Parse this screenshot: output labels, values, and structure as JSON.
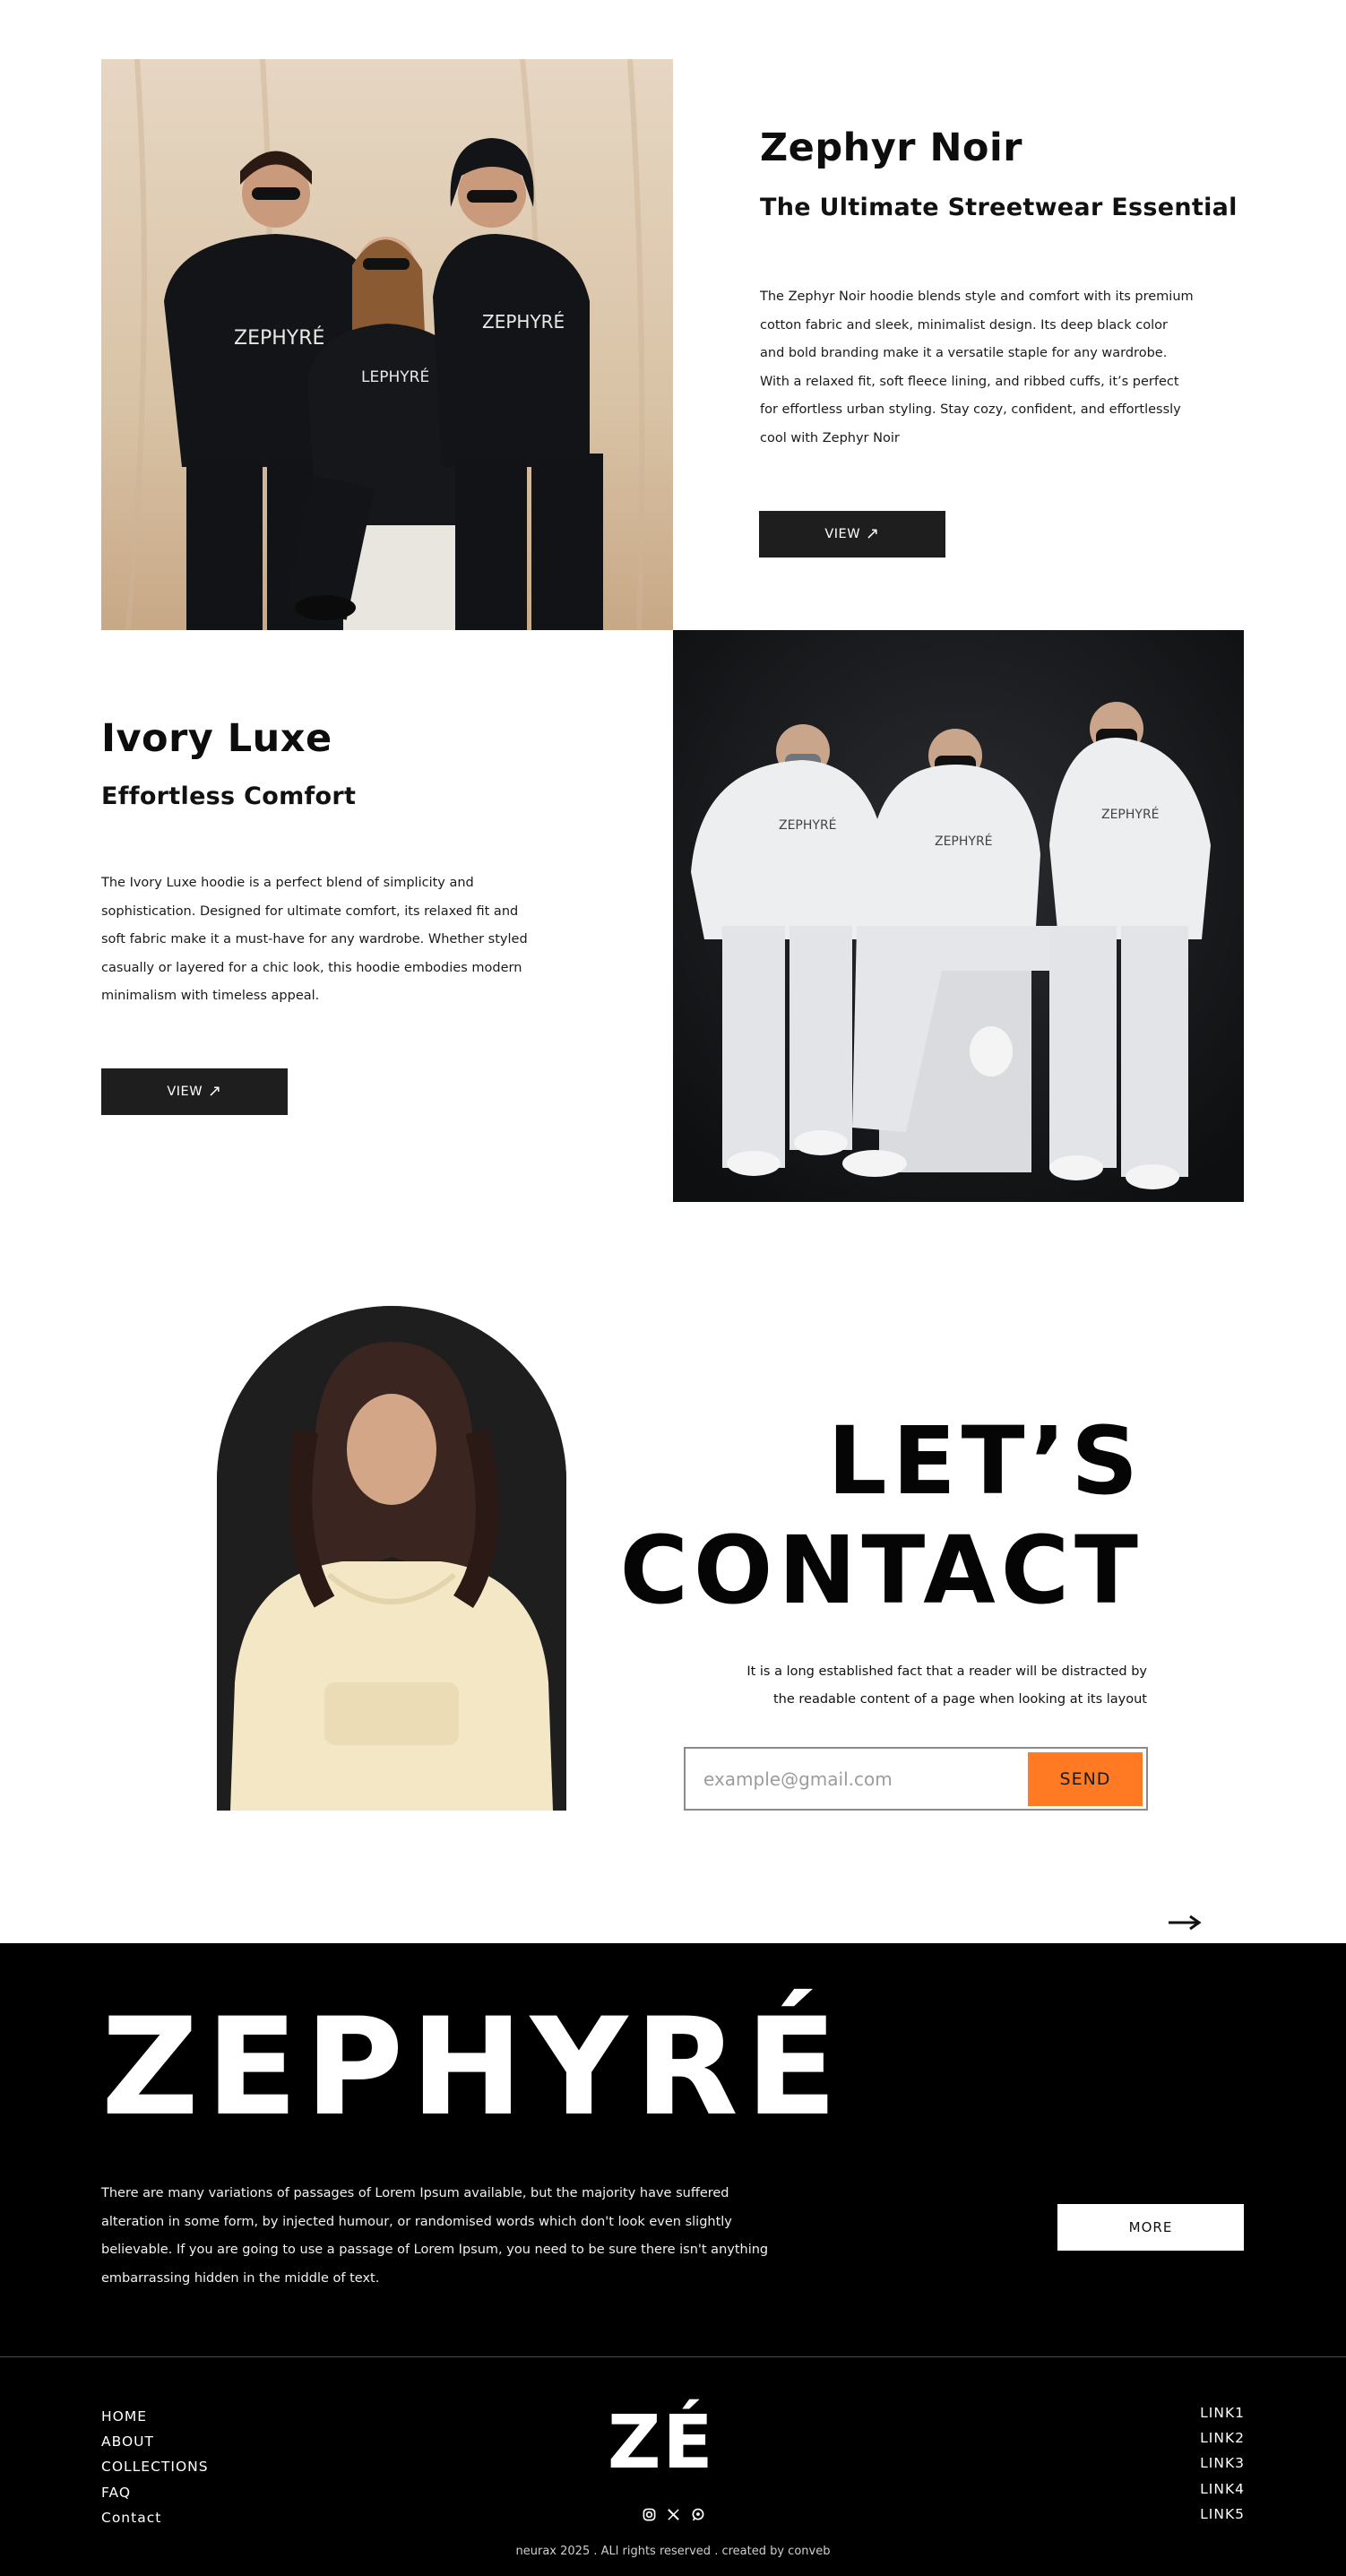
{
  "products": [
    {
      "title": "Zephyr Noir",
      "subtitle": "The Ultimate Streetwear Essential",
      "description_lines": [
        "The Zephyr Noir hoodie blends style and comfort with its premium",
        "cotton fabric and sleek, minimalist design. Its deep black color",
        "and bold branding make it a versatile staple for any wardrobe.",
        "With a relaxed fit, soft fleece lining, and ribbed cuffs, it’s perfect",
        "for effortless urban styling. Stay cozy, confident, and effortlessly",
        "cool with Zephyr Noir"
      ],
      "button_label": "VIEW",
      "hoodie_print": "ZEPHYRÉ"
    },
    {
      "title": "Ivory Luxe",
      "subtitle": "Effortless Comfort",
      "description_lines": [
        "The Ivory Luxe hoodie is a perfect blend of simplicity and",
        "sophistication. Designed for ultimate comfort, its relaxed fit and",
        "soft fabric make it a must-have for any wardrobe. Whether styled",
        "casually or layered for a chic look, this hoodie embodies modern",
        "minimalism with timeless appeal."
      ],
      "button_label": "VIEW",
      "hoodie_print": "ZEPHYRÉ"
    }
  ],
  "contact": {
    "heading_line1": "LET’S",
    "heading_line2": "CONTACT",
    "description_lines": [
      "It is a long established fact that a reader will be distracted by",
      "the readable content of a page when looking at its layout"
    ],
    "email_placeholder": "example@gmail.com",
    "send_label": "SEND"
  },
  "footer": {
    "brand": "ZEPHYRÉ",
    "description_lines": [
      "There are many variations of passages of Lorem Ipsum available, but the majority have suffered",
      "alteration in some form, by injected humour, or randomised words which don't look even slightly",
      "believable. If you are going to use a passage of Lorem Ipsum, you need to be sure there isn't anything",
      "embarrassing hidden in the middle of text."
    ],
    "more_label": "MORE",
    "nav_left": [
      "HOME",
      "ABOUT",
      "COLLECTIONS",
      "FAQ",
      "Contact"
    ],
    "brand_short": "ZÉ",
    "nav_right": [
      "LINK1",
      "LINK2",
      "LINK3",
      "LINK4",
      "LINK5"
    ],
    "copyright": "neurax 2025 . ALl rights reserved . created by conveb",
    "social_icons": [
      "instagram-icon",
      "x-icon",
      "whatsapp-icon"
    ]
  },
  "colors": {
    "accent": "#ff7a22",
    "dark": "#1e1e1e",
    "footer_bg": "#000000"
  }
}
